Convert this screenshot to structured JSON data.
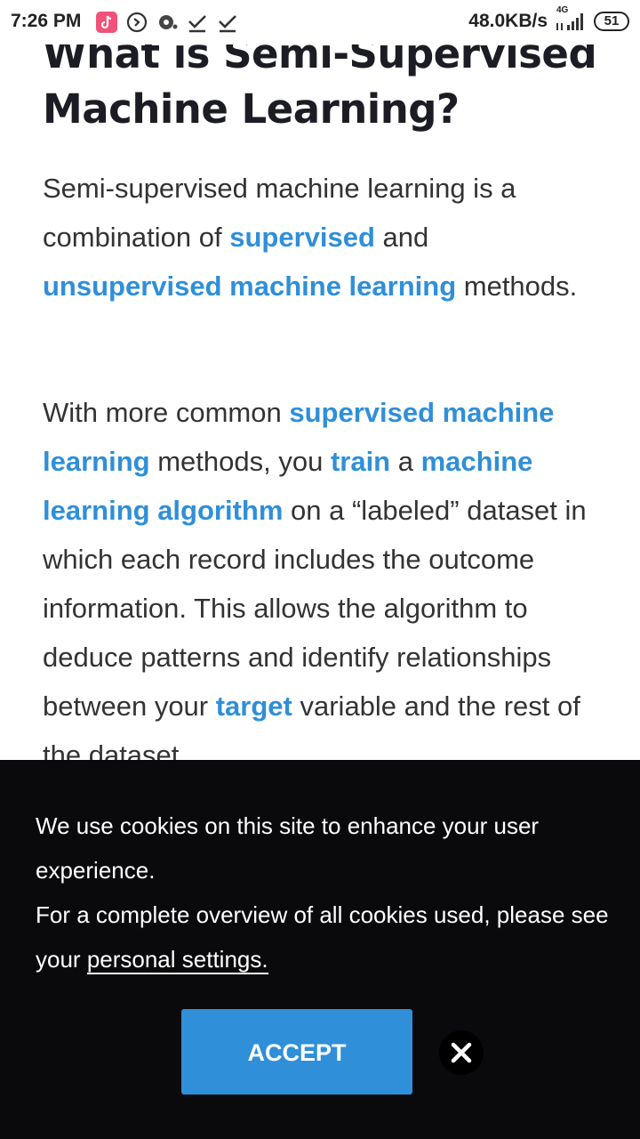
{
  "status_bar": {
    "time": "7:26 PM",
    "speed": "48.0KB/s",
    "network": "4G",
    "battery": "51"
  },
  "article": {
    "heading": "What is Semi-Supervised Machine Learning?",
    "p1": {
      "t1": "Semi-supervised machine learning is a combination of ",
      "link1": "supervised",
      "t2": " and ",
      "link2": "unsupervised machine learning",
      "t3": " methods."
    },
    "p2": {
      "t1": "With more common ",
      "link1": "supervised machine learning",
      "t2": " methods, you ",
      "link2": "train",
      "t3": " a ",
      "link3": "machine learning algorithm",
      "t4": " on a “labeled” dataset in which each record includes the outcome information. This allows the algorithm to deduce patterns and identify relationships between your ",
      "link4": "target",
      "t5": " variable and the rest of the dataset."
    }
  },
  "cookie_banner": {
    "line1": "We use cookies on this site to enhance your user experience.",
    "line2_prefix": "For a complete overview of all cookies used, please see your ",
    "settings_link": "personal settings.",
    "accept_label": "ACCEPT"
  },
  "colors": {
    "link": "#2f8fd8",
    "banner_bg": "#0a0a0c",
    "accept_bg": "#2f8fd8"
  }
}
